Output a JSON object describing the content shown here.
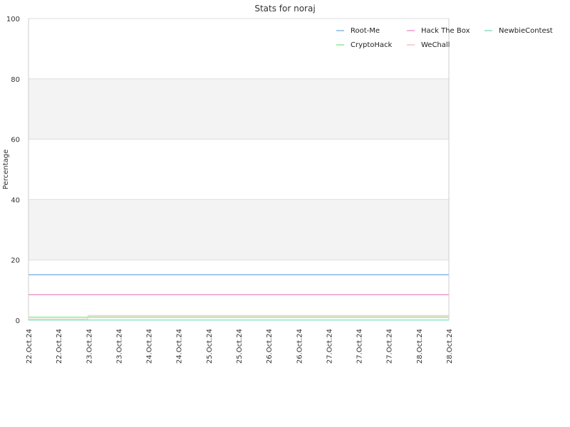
{
  "chart_data": {
    "type": "line",
    "title": "Stats for noraj",
    "xlabel": "",
    "ylabel": "Percentage",
    "ylim": [
      0,
      100
    ],
    "yticks": [
      0,
      20,
      40,
      60,
      80,
      100
    ],
    "grid": true,
    "alternating_bands": true,
    "legend_position": "top-right",
    "x_tick_labels": [
      "22.Oct.24",
      "22.Oct.24",
      "23.Oct.24",
      "23.Oct.24",
      "24.Oct.24",
      "24.Oct.24",
      "25.Oct.24",
      "25.Oct.24",
      "26.Oct.24",
      "26.Oct.24",
      "27.Oct.24",
      "27.Oct.24",
      "27.Oct.24",
      "28.Oct.24",
      "28.Oct.24"
    ],
    "x": [
      0,
      1,
      1.95,
      2,
      14
    ],
    "series": [
      {
        "name": "Root-Me",
        "color": "#a5c8ee",
        "values": [
          15.1,
          15.1,
          15.1,
          15.1,
          15.1
        ]
      },
      {
        "name": "Hack The Box",
        "color": "#f4b0d6",
        "values": [
          8.5,
          8.5,
          8.5,
          8.5,
          8.5
        ]
      },
      {
        "name": "NewbieContest",
        "color": "#a8e6cf",
        "values": [
          0.1,
          0.1,
          0.1,
          0.1,
          0.1
        ]
      },
      {
        "name": "CryptoHack",
        "color": "#a8f0a8",
        "values": [
          1.0,
          1.0,
          1.0,
          1.0,
          1.0
        ]
      },
      {
        "name": "WeChall",
        "color": "#f8d0d0",
        "values": [
          0.3,
          0.3,
          0.3,
          1.5,
          1.5
        ]
      }
    ],
    "legend_order": [
      "Root-Me",
      "Hack The Box",
      "NewbieContest",
      "CryptoHack",
      "WeChall"
    ]
  }
}
